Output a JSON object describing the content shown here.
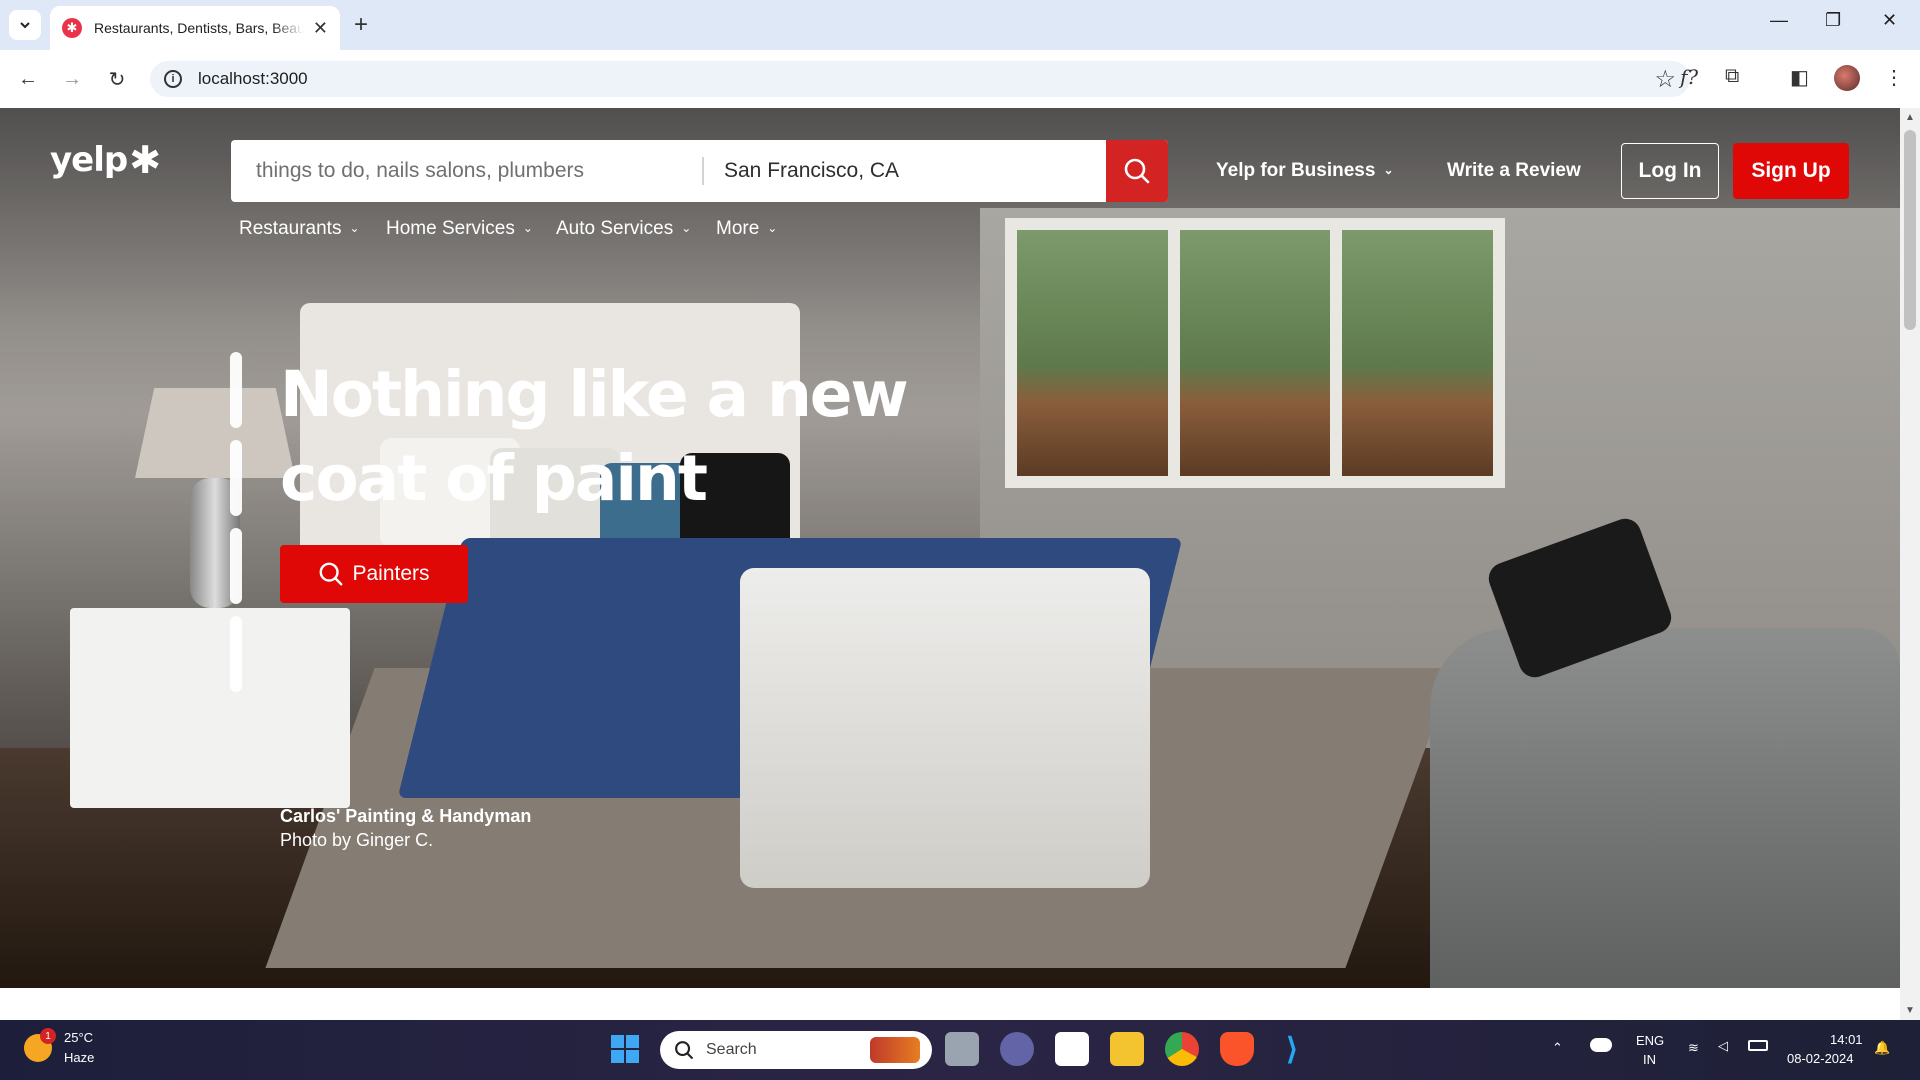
{
  "browser": {
    "tab_title": "Restaurants, Dentists, Bars, Beauty Salons, Doctors",
    "new_tab": "+",
    "url": "localhost:3000",
    "window_controls": [
      "—",
      "❐",
      "✕"
    ]
  },
  "header": {
    "logo": "yelp",
    "search_placeholder": "things to do, nails salons, plumbers",
    "location_value": "San Francisco, CA",
    "business_link": "Yelp for Business",
    "review_link": "Write a Review",
    "login": "Log In",
    "signup": "Sign Up"
  },
  "categories": [
    "Restaurants",
    "Home Services",
    "Auto Services",
    "More"
  ],
  "hero": {
    "headline_line1": "Nothing like a new",
    "headline_line2": "coat of paint",
    "cta": "Painters",
    "credit_name": "Carlos' Painting & Handyman",
    "credit_by": "Photo by Ginger C."
  },
  "taskbar": {
    "temperature": "25°C",
    "weather": "Haze",
    "weather_badge": "1",
    "search": "Search",
    "lang_top": "ENG",
    "lang_bottom": "IN",
    "time": "14:01",
    "date": "08-02-2024"
  },
  "colors": {
    "brand_red": "#d32323",
    "button_red": "#e00707"
  }
}
